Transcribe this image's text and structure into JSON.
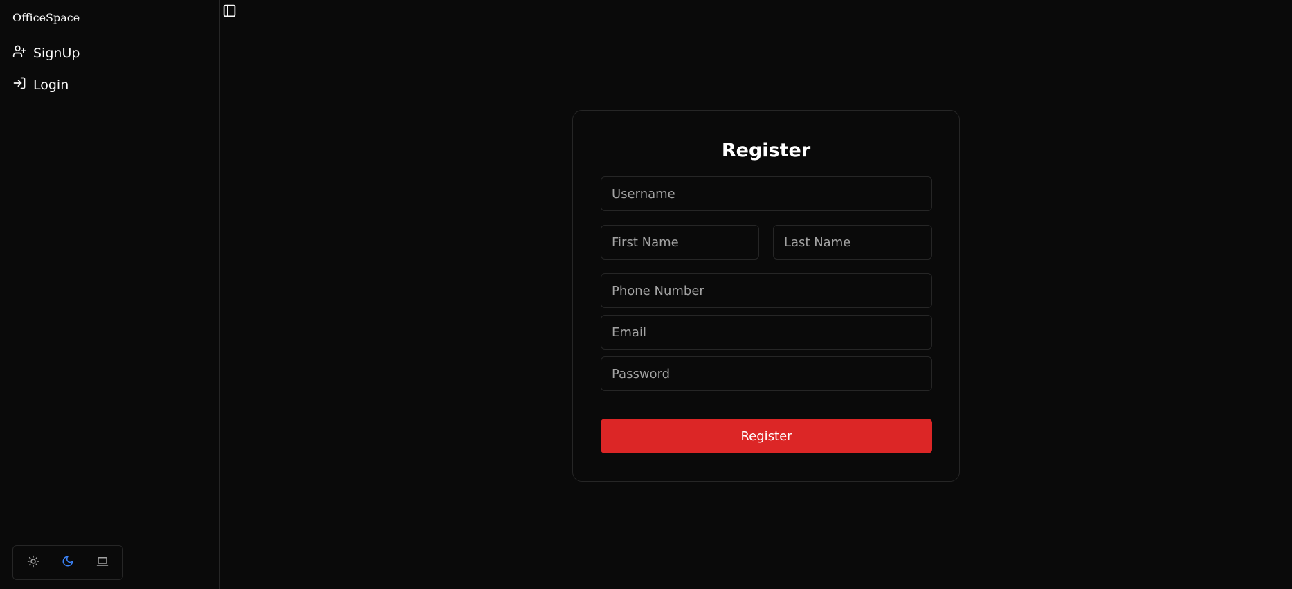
{
  "sidebar": {
    "brand": "OfficeSpace",
    "items": [
      {
        "label": "SignUp",
        "icon": "user-plus-icon"
      },
      {
        "label": "Login",
        "icon": "log-in-icon"
      }
    ],
    "theme": {
      "options": [
        "light",
        "dark",
        "system"
      ],
      "selected": "dark",
      "accent": "#3b82f6"
    }
  },
  "form": {
    "title": "Register",
    "username_placeholder": "Username",
    "first_name_placeholder": "First Name",
    "last_name_placeholder": "Last Name",
    "phone_placeholder": "Phone Number",
    "email_placeholder": "Email",
    "password_placeholder": "Password",
    "submit_label": "Register",
    "submit_color": "#dc2626"
  }
}
